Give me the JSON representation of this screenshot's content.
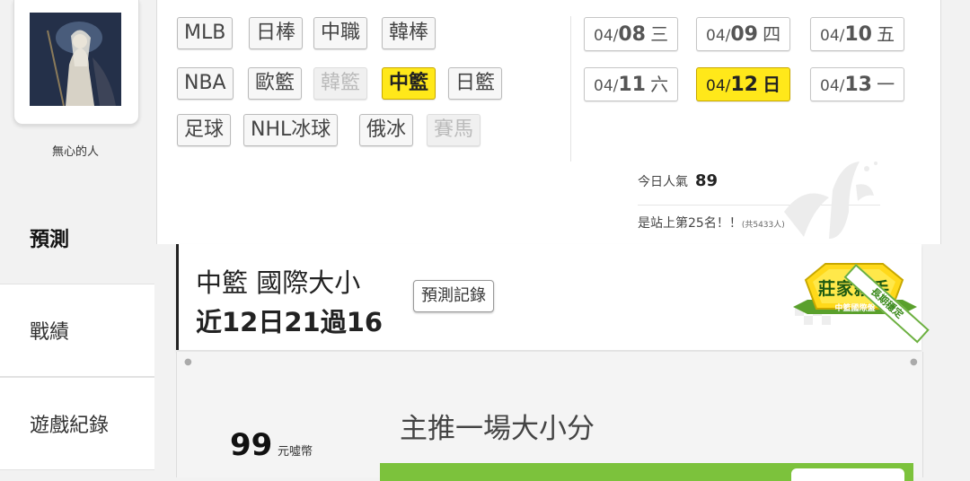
{
  "user": {
    "name": "無心的人"
  },
  "sidebar": {
    "tabs": [
      {
        "label": "預測",
        "active": true
      },
      {
        "label": "戰績",
        "active": false
      },
      {
        "label": "遊戲紀錄",
        "active": false
      }
    ]
  },
  "leagues": [
    {
      "label": "MLB",
      "state": "normal"
    },
    {
      "label": "日棒",
      "state": "normal"
    },
    {
      "label": "中職",
      "state": "normal"
    },
    {
      "label": "韓棒",
      "state": "normal"
    },
    {
      "label": "NBA",
      "state": "normal"
    },
    {
      "label": "歐籃",
      "state": "normal"
    },
    {
      "label": "韓籃",
      "state": "disabled"
    },
    {
      "label": "中籃",
      "state": "active"
    },
    {
      "label": "日籃",
      "state": "normal"
    },
    {
      "label": "足球",
      "state": "normal"
    },
    {
      "label": "NHL冰球",
      "state": "normal"
    },
    {
      "label": "俄冰",
      "state": "normal"
    },
    {
      "label": "賽馬",
      "state": "disabled"
    }
  ],
  "dates": [
    {
      "md": "04/",
      "day": "08",
      "weekday": "三",
      "active": false
    },
    {
      "md": "04/",
      "day": "09",
      "weekday": "四",
      "active": false
    },
    {
      "md": "04/",
      "day": "10",
      "weekday": "五",
      "active": false
    },
    {
      "md": "04/",
      "day": "11",
      "weekday": "六",
      "active": false
    },
    {
      "md": "04/",
      "day": "12",
      "weekday": "日",
      "active": true
    },
    {
      "md": "04/",
      "day": "13",
      "weekday": "一",
      "active": false
    }
  ],
  "popularity": {
    "label": "今日人氣",
    "value": "89",
    "rank_text": "是站上第25名！！",
    "rank_count": "(共5433人)"
  },
  "title": {
    "line1": "中籃 國際大小",
    "line2": "近12日21過16",
    "record_button": "預測記錄"
  },
  "badge": {
    "main": "莊家殺手",
    "sub": "中籃國際盤",
    "ribbon": "長期穩定"
  },
  "content": {
    "coins": "99",
    "coin_unit": "元噓幣",
    "main_pick": "主推一場大小分"
  },
  "colors": {
    "accent_yellow": "#ffe81a",
    "badge_green": "#7cc23c",
    "title_border": "#222222"
  }
}
